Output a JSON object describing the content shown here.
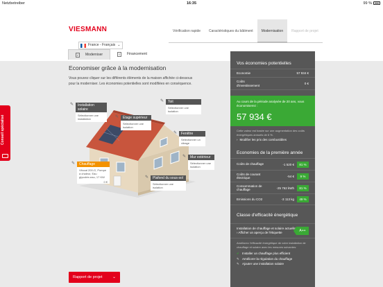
{
  "statusbar": {
    "carrier": "Netzbetreiber",
    "time": "16:35",
    "battery": "99 %"
  },
  "header": {
    "logo": "VIESMANN",
    "tabs": [
      {
        "label": "Vérification rapide",
        "state": "normal"
      },
      {
        "label": "Caractéristiques du bâtiment",
        "state": "normal"
      },
      {
        "label": "Modernisation",
        "state": "active"
      },
      {
        "label": "Rapport de projet",
        "state": "disabled"
      }
    ],
    "language": "France - Français"
  },
  "subtabs": [
    {
      "label": "Moderniser"
    },
    {
      "label": "Financement"
    }
  ],
  "main": {
    "title": "Economiser grâce à la modernisation",
    "intro": "Vous pouvez cliquer sur les différents éléments de la maison affichée ci-dessous pour la moderniser. Les économies potentielles sont modifiées en conséquence.",
    "callouts": {
      "solar": {
        "title": "Installation solaire",
        "body": "Sélectionner une installation"
      },
      "roof": {
        "title": "Toit",
        "body": "Sélectionner une isolation"
      },
      "upper_floor": {
        "title": "Étage supérieur",
        "body": "Sélectionner une isolation"
      },
      "window": {
        "title": "Fenêtre",
        "body": "Sélectionner un vitrage"
      },
      "outer_wall": {
        "title": "Mur extérieur",
        "body": "Sélectionner une isolation"
      },
      "heating": {
        "title": "Chauffage",
        "body": "Vitocal 200-G, Pompe à chaleur, Eau glycolée-eau, 17 KW",
        "value": "0 €"
      },
      "basement_ceiling": {
        "title": "Plafond du sous-sol",
        "body": "Sélectionner une isolation"
      }
    },
    "side_tab": "Conseil spécialisé",
    "report_button": "Rapport de projet"
  },
  "panel": {
    "title": "Vos économies potentielles",
    "rows": [
      {
        "label": "Economie",
        "value": "57 934 €"
      },
      {
        "label": "Coûts d'investissement",
        "value": "0 €"
      }
    ],
    "period_text": "Au cours de la période analysée de 20 ans, vous économiserez :",
    "period_value": "57 934 €",
    "note": "Cette valeur est basée sur une augmentation des coûts énergétiques annuels de 6 %.",
    "link_fuel": "Modifier les prix des combustibles",
    "first_year_title": "Economies de la première année",
    "first_year": [
      {
        "label": "Coûts de chauffage",
        "value": "-1 520 €",
        "pct": "81 %"
      },
      {
        "label": "Coûts de courant électrique",
        "value": "-54 €",
        "pct": "9 %"
      },
      {
        "label": "Consommation de chauffage",
        "value": "-25 762 kWh",
        "pct": "81 %"
      },
      {
        "label": "Emissions du CO2",
        "value": "-3 113 kg",
        "pct": "49 %"
      }
    ],
    "efficiency_title": "Classe d'efficacité énergétique",
    "efficiency_label": "Installation de chauffage et solaire actuelle",
    "efficiency_badge": "A++",
    "efficiency_link": "Afficher un aperçu de l'étiquette",
    "efficiency_note": "Améliorez l'efficacité énergétique de votre installation de chauffage et solaire avec les mesures suivantes:",
    "checklist": [
      {
        "label": "Installer un chauffage plus efficient",
        "done": true
      },
      {
        "label": "Améliorer la régulation du chauffage",
        "done": false
      },
      {
        "label": "Ajouter une installation solaire",
        "done": false
      }
    ]
  }
}
